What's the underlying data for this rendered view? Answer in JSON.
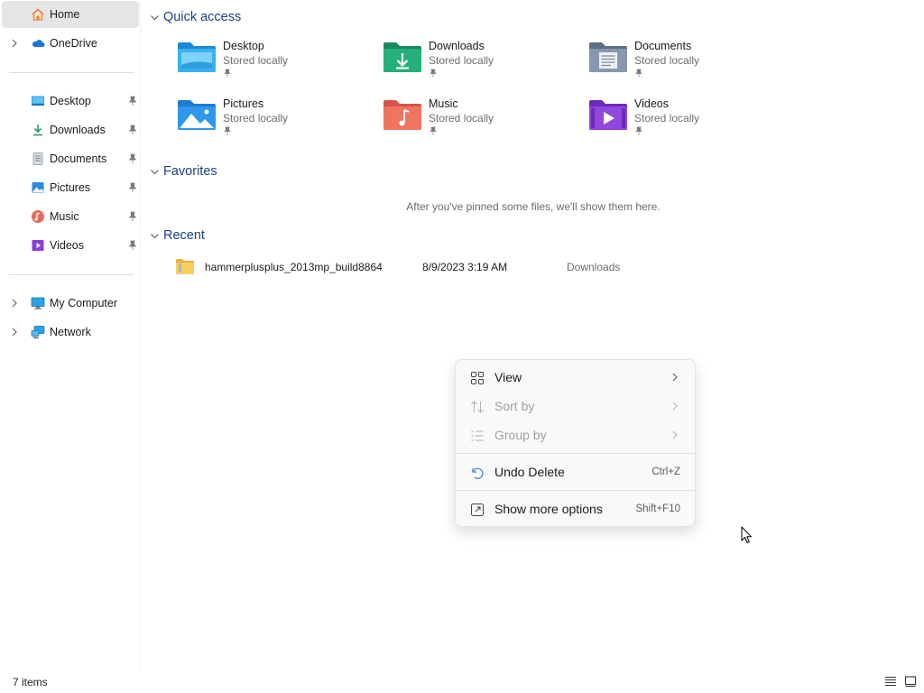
{
  "sidebar": {
    "home": {
      "label": "Home",
      "icon": "home-icon"
    },
    "onedrive": {
      "label": "OneDrive",
      "icon": "onedrive-icon"
    },
    "pinned": [
      {
        "label": "Desktop",
        "icon": "desktop-icon"
      },
      {
        "label": "Downloads",
        "icon": "downloads-icon"
      },
      {
        "label": "Documents",
        "icon": "documents-icon"
      },
      {
        "label": "Pictures",
        "icon": "pictures-icon"
      },
      {
        "label": "Music",
        "icon": "music-icon"
      },
      {
        "label": "Videos",
        "icon": "videos-icon"
      }
    ],
    "my_computer": {
      "label": "My Computer",
      "icon": "monitor-icon"
    },
    "network": {
      "label": "Network",
      "icon": "network-icon"
    }
  },
  "quick_access": {
    "title": "Quick access",
    "items": [
      {
        "name": "Desktop",
        "status": "Stored locally",
        "icon": "desktop-folder-icon"
      },
      {
        "name": "Downloads",
        "status": "Stored locally",
        "icon": "downloads-folder-icon"
      },
      {
        "name": "Documents",
        "status": "Stored locally",
        "icon": "documents-folder-icon"
      },
      {
        "name": "Pictures",
        "status": "Stored locally",
        "icon": "pictures-folder-icon"
      },
      {
        "name": "Music",
        "status": "Stored locally",
        "icon": "music-folder-icon"
      },
      {
        "name": "Videos",
        "status": "Stored locally",
        "icon": "videos-folder-icon"
      }
    ]
  },
  "favorites": {
    "title": "Favorites",
    "empty_message": "After you've pinned some files, we'll show them here."
  },
  "recent": {
    "title": "Recent",
    "items": [
      {
        "name": "hammerplusplus_2013mp_build8864",
        "date": "8/9/2023 3:19 AM",
        "location": "Downloads",
        "icon": "zip-folder-icon"
      }
    ]
  },
  "context_menu": {
    "items": [
      {
        "label": "View",
        "icon": "view-grid-icon",
        "enabled": true,
        "submenu": true
      },
      {
        "label": "Sort by",
        "icon": "sort-icon",
        "enabled": false,
        "submenu": true
      },
      {
        "label": "Group by",
        "icon": "group-icon",
        "enabled": false,
        "submenu": true
      },
      {
        "label": "Undo Delete",
        "icon": "undo-icon",
        "enabled": true,
        "shortcut": "Ctrl+Z"
      },
      {
        "label": "Show more options",
        "icon": "show-more-options-icon",
        "enabled": true,
        "shortcut": "Shift+F10"
      }
    ]
  },
  "status_bar": {
    "item_count": "7 items",
    "views": [
      "details-view-icon",
      "tiles-view-icon"
    ]
  },
  "colors": {
    "section_title": "#1f3f80",
    "selected_bg": "#e5e5e5",
    "menu_bg": "#f9f9f9"
  }
}
